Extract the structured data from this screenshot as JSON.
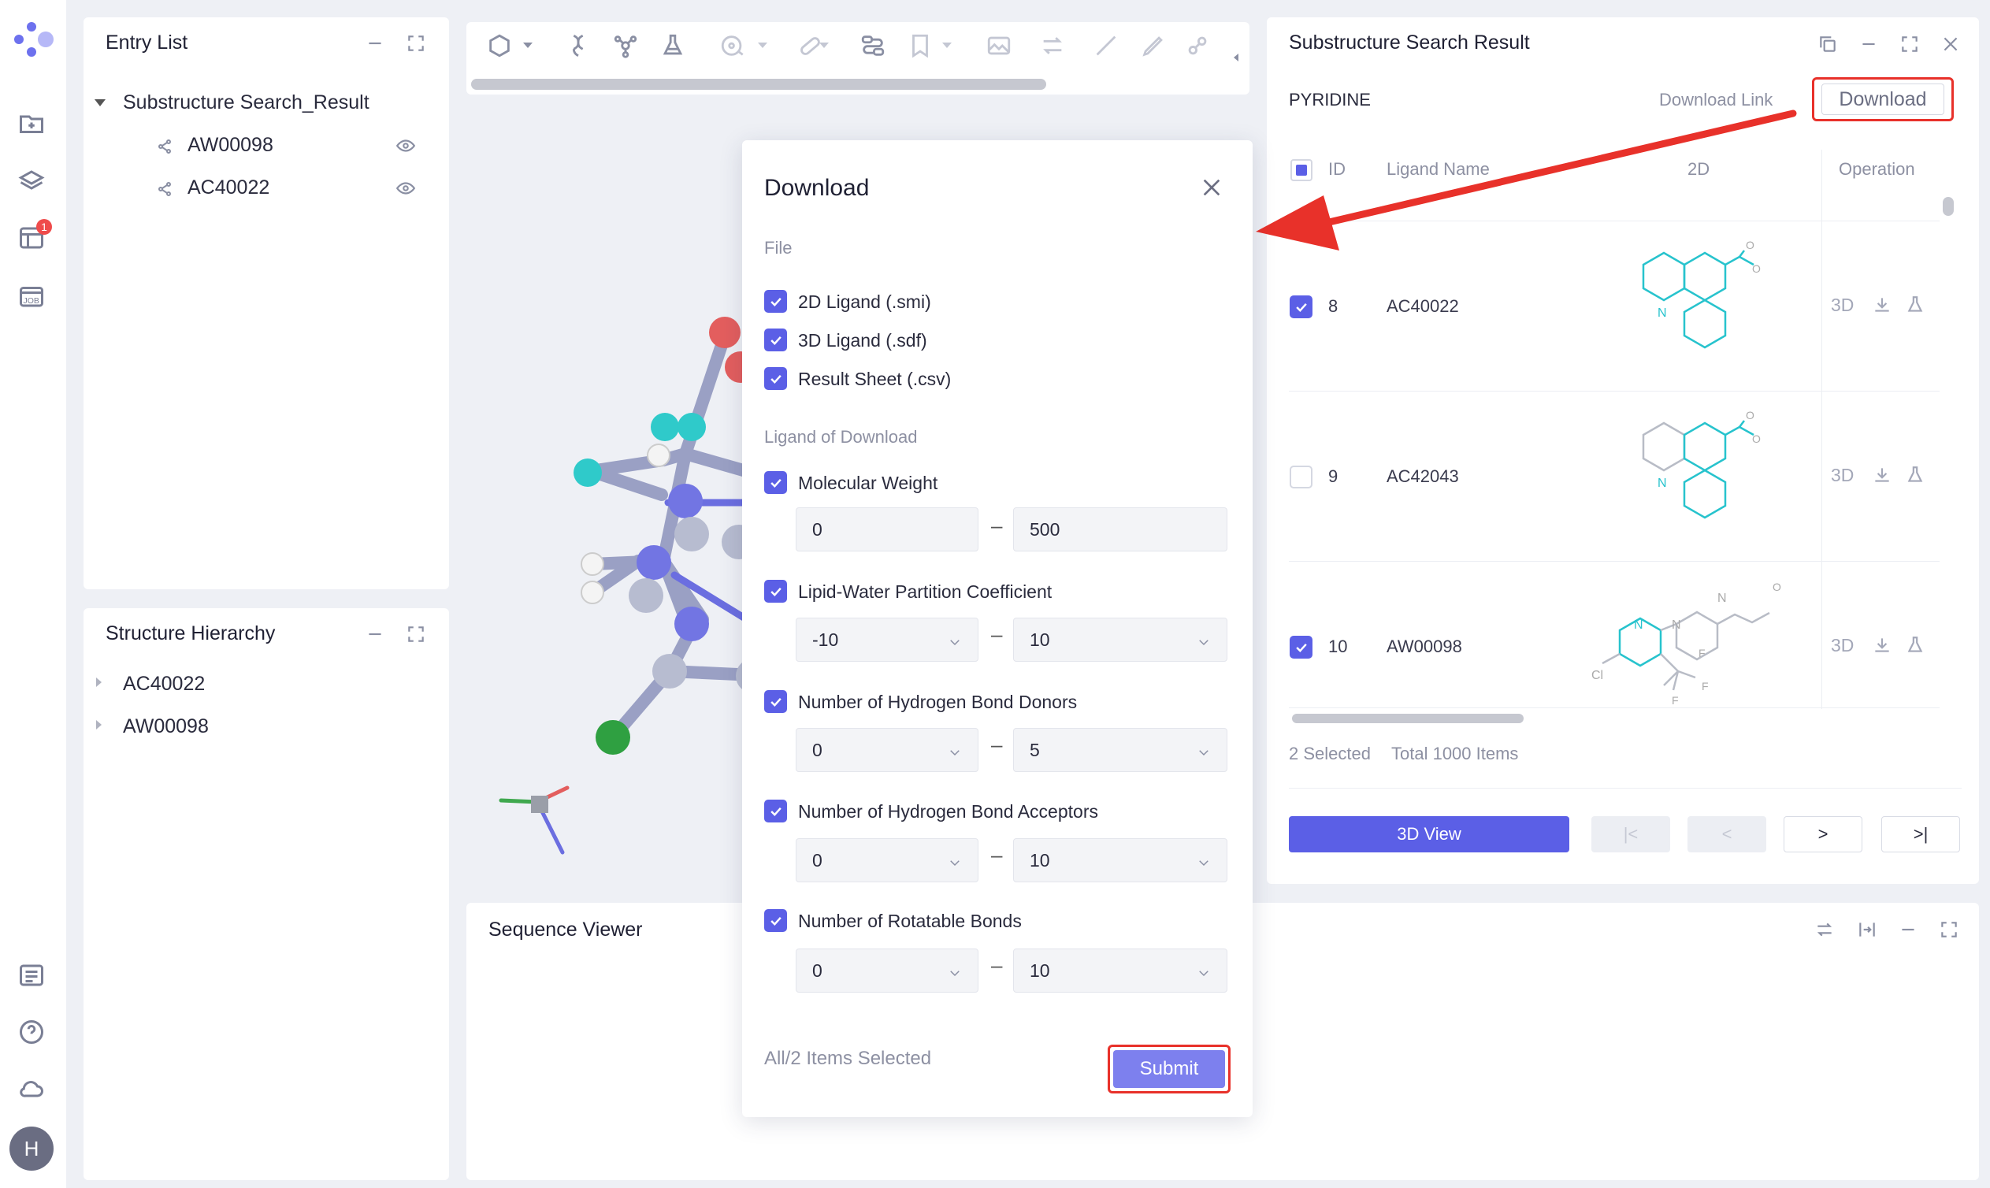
{
  "sidebar": {
    "badge_count": "1",
    "avatar_initial": "H",
    "icons": [
      "new-folder-icon",
      "layers-icon",
      "table-icon",
      "job-icon",
      "list-icon",
      "help-icon",
      "cloud-icon"
    ]
  },
  "entry_list": {
    "title": "Entry List",
    "group": "Substructure Search_Result",
    "items": [
      "AW00098",
      "AC40022"
    ]
  },
  "structure_hierarchy": {
    "title": "Structure Hierarchy",
    "items": [
      "AC40022",
      "AW00098"
    ]
  },
  "sequence_viewer": {
    "title": "Sequence Viewer"
  },
  "download_dialog": {
    "title": "Download",
    "file_section": "File",
    "files": [
      {
        "label": "2D Ligand (.smi)",
        "checked": true
      },
      {
        "label": "3D Ligand (.sdf)",
        "checked": true
      },
      {
        "label": "Result Sheet (.csv)",
        "checked": true
      }
    ],
    "ligand_section": "Ligand of Download",
    "filters": [
      {
        "label": "Molecular Weight",
        "checked": true,
        "min": "0",
        "max": "500",
        "type": "input"
      },
      {
        "label": "Lipid-Water Partition Coefficient",
        "checked": true,
        "min": "-10",
        "max": "10",
        "type": "select"
      },
      {
        "label": "Number of Hydrogen Bond Donors",
        "checked": true,
        "min": "0",
        "max": "5",
        "type": "select"
      },
      {
        "label": "Number of Hydrogen Bond Acceptors",
        "checked": true,
        "min": "0",
        "max": "10",
        "type": "select"
      },
      {
        "label": "Number of Rotatable Bonds",
        "checked": true,
        "min": "0",
        "max": "10",
        "type": "select"
      }
    ],
    "range_dash": "–",
    "footer_text": "All/2 Items Selected",
    "submit_label": "Submit"
  },
  "result_panel": {
    "title": "Substructure Search Result",
    "query": "PYRIDINE",
    "download_link_label": "Download Link",
    "download_label": "Download",
    "columns": {
      "id": "ID",
      "ligand_name": "Ligand Name",
      "twod": "2D",
      "operation": "Operation"
    },
    "rows": [
      {
        "id": "8",
        "name": "AC40022",
        "checked": true,
        "op_3d": "3D"
      },
      {
        "id": "9",
        "name": "AC42043",
        "checked": false,
        "op_3d": "3D"
      },
      {
        "id": "10",
        "name": "AW00098",
        "checked": true,
        "op_3d": "3D"
      }
    ],
    "selected_text": "2 Selected",
    "total_text": "Total 1000 Items",
    "view_button": "3D View",
    "page_buttons": [
      "|<",
      "<",
      ">",
      ">|"
    ]
  },
  "colors": {
    "accent": "#5b5fe6",
    "highlight": "#e8312a",
    "molecule_cyan": "#21c4c9"
  }
}
